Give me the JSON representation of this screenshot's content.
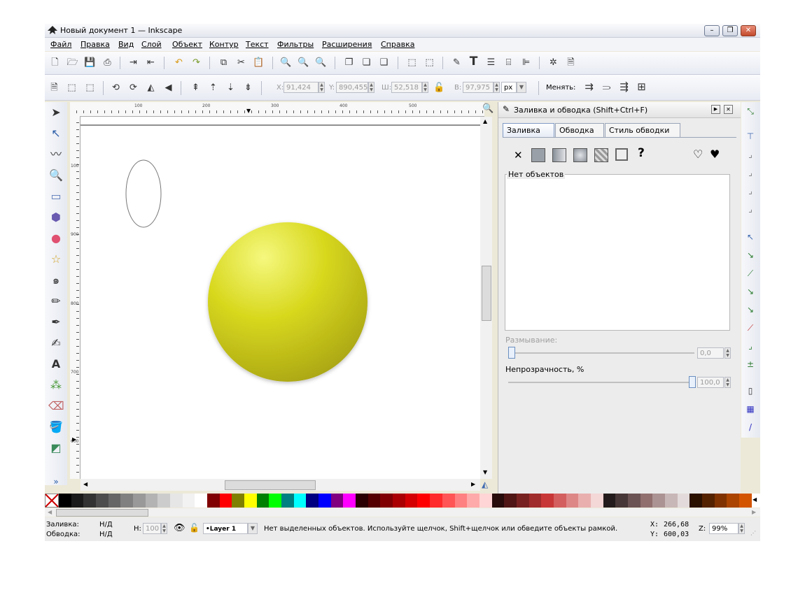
{
  "window": {
    "title": "Новый документ 1 — Inkscape"
  },
  "menu": [
    "Файл",
    "Правка",
    "Вид",
    "Слой",
    "Объект",
    "Контур",
    "Текст",
    "Фильтры",
    "Расширения",
    "Справка"
  ],
  "toolctrl": {
    "x_label": "X:",
    "x_value": "91,424",
    "y_label": "Y:",
    "y_value": "890,455",
    "w_label": "Ш:",
    "w_value": "52,518",
    "h_label": "В:",
    "h_value": "97,975",
    "unit": "px",
    "change_label": "Менять:"
  },
  "rulers": {
    "h_ticks": [
      "100",
      "200",
      "300",
      "400",
      "500"
    ],
    "v_ticks": [
      "100",
      "900",
      "800",
      "700",
      "600"
    ]
  },
  "dock": {
    "title": "Заливка и обводка (Shift+Ctrl+F)",
    "tabs": [
      "Заливка",
      "Обводка",
      "Стиль обводки"
    ],
    "question": "?",
    "no_objects": "Нет объектов",
    "blur_label": "Размывание:",
    "blur_value": "0,0",
    "opacity_label": "Непрозрачность, %",
    "opacity_value": "100,0",
    "blur_fraction": 0.0,
    "opacity_fraction": 1.0
  },
  "status": {
    "fill_label": "Заливка:",
    "fill_value": "Н/Д",
    "stroke_label": "Обводка:",
    "stroke_value": "Н/Д",
    "h_label": "H:",
    "h_value": "100",
    "layer": "•Layer 1",
    "message": "Нет выделенных объектов. Используйте щелчок, Shift+щелчок или обведите объекты рамкой.",
    "x_label": "X:",
    "x_value": "266,68",
    "y_label": "Y:",
    "y_value": "600,03",
    "zoom_label": "Z:",
    "zoom_value": "99%"
  },
  "colors": {
    "ball": "#d8d81e",
    "accent": "#3f69b0",
    "palette": [
      "#000000",
      "#1a1a1a",
      "#333333",
      "#4d4d4d",
      "#666666",
      "#808080",
      "#999999",
      "#b3b3b3",
      "#cccccc",
      "#e6e6e6",
      "#f2f2f2",
      "#ffffff",
      "#800000",
      "#ff0000",
      "#808000",
      "#ffff00",
      "#008000",
      "#00ff00",
      "#008080",
      "#00ffff",
      "#000080",
      "#0000ff",
      "#800080",
      "#ff00ff",
      "#2b0000",
      "#550000",
      "#800000",
      "#aa0000",
      "#d40000",
      "#ff0000",
      "#ff2a2a",
      "#ff5555",
      "#ff8080",
      "#ffaaaa",
      "#ffd5d5",
      "#280b0b",
      "#501616",
      "#782121",
      "#a02c2c",
      "#c83737",
      "#d35f5f",
      "#de8787",
      "#e9afaf",
      "#f4d7d7",
      "#241c1c",
      "#483737",
      "#6c5353",
      "#916f6f",
      "#ac9393",
      "#c8b7b7",
      "#e3dbdb",
      "#2b1100",
      "#552200",
      "#803300",
      "#aa4400",
      "#d45500"
    ]
  }
}
